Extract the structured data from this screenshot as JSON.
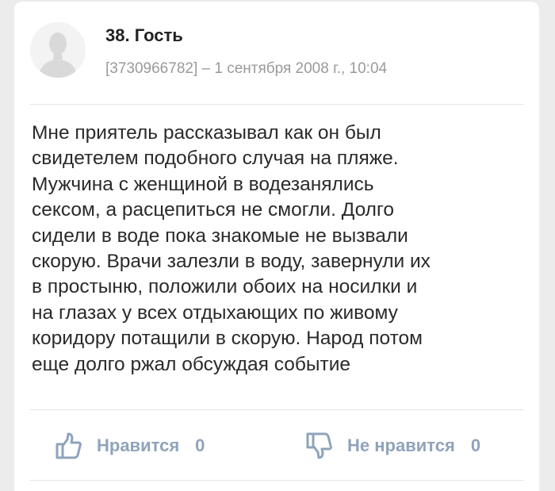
{
  "comment": {
    "author": "38. Гость",
    "meta": "[3730966782] – 1 сентября 2008 г., 10:04",
    "text": "Мне приятель рассказывал как он был\nсвидетелем подобного случая на пляже.\nМужчина с женщиной в водезанялись\nсексом, а расцепиться не смогли. Долго\nсидели в воде пока знакомые не вызвали\nскорую. Врачи залезли в воду, завернули их\nв простыню, положили обоих на носилки и\nна глазах у всех отдыхающих по живому\nкоридору потащили в скорую. Народ потом\nеще долго ржал обсуждая событие"
  },
  "actions": {
    "like": {
      "label": "Нравится",
      "count": "0",
      "icon": "thumbs-up-icon"
    },
    "dislike": {
      "label": "Не нравится",
      "count": "0",
      "icon": "thumbs-down-icon"
    }
  },
  "colors": {
    "action_accent": "#8fa3bb",
    "meta_gray": "#9a9a9a"
  }
}
